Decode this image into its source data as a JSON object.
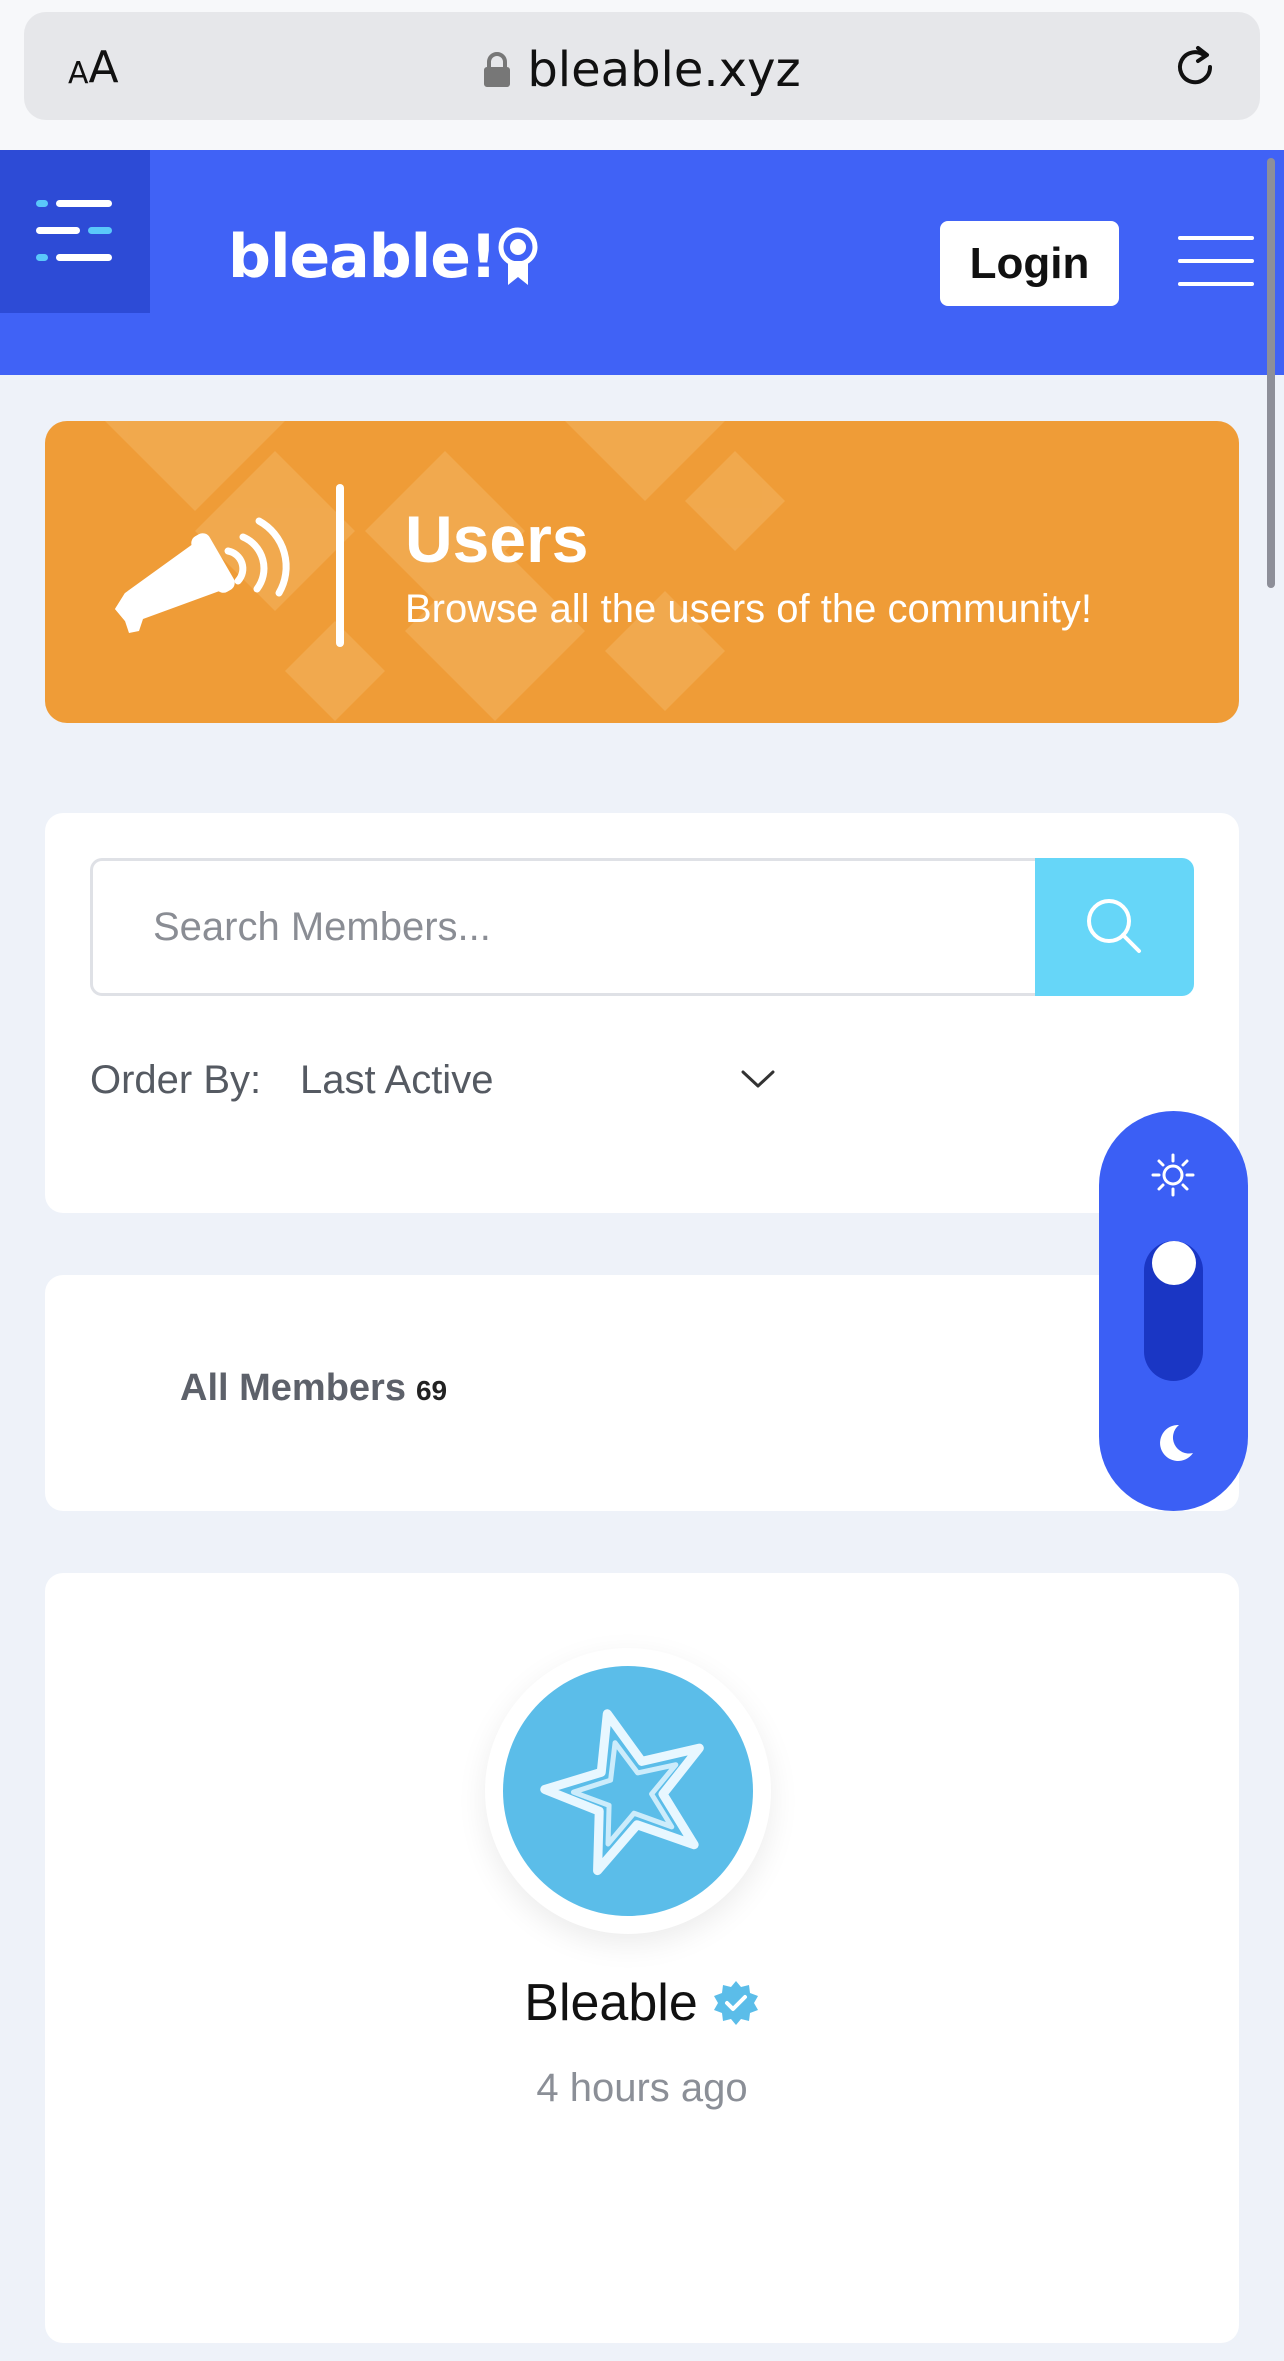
{
  "browser": {
    "text_size_small": "A",
    "text_size_big": "A",
    "url": "bleable.xyz"
  },
  "header": {
    "logo_text": "bleable!",
    "login_label": "Login",
    "brand_color": "#4062f6"
  },
  "banner": {
    "title": "Users",
    "subtitle": "Browse all the users of the community!",
    "color": "#ef9c37"
  },
  "search": {
    "placeholder": "Search Members...",
    "order_label": "Order By:",
    "order_value": "Last Active"
  },
  "members_tab": {
    "label": "All Members",
    "count": "69"
  },
  "theme_switch": {
    "mode": "light",
    "icons": [
      "sun-icon",
      "moon-icon"
    ]
  },
  "members": [
    {
      "name": "Bleable",
      "verified": true,
      "last_active": "4 hours ago",
      "avatar_icon": "star-icon"
    }
  ]
}
